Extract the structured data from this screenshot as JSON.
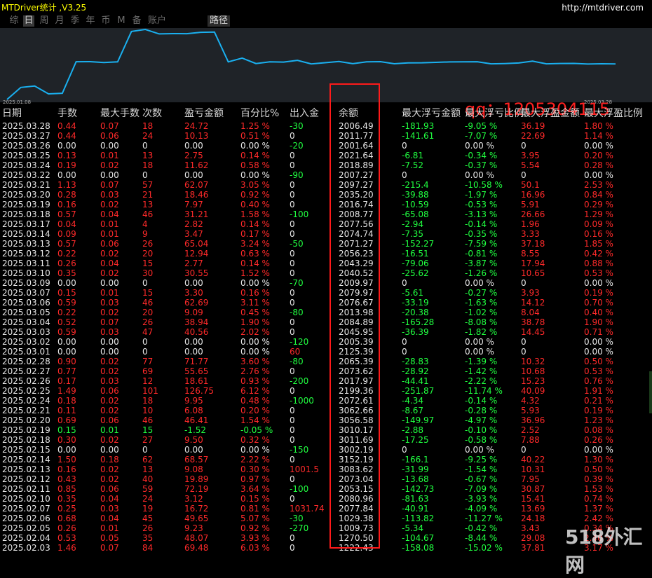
{
  "window": {
    "title": "MTDriver统计 ,V3.25",
    "url": "http://mtdriver.com"
  },
  "tabs": [
    {
      "label": "综",
      "active": false
    },
    {
      "label": "日",
      "active": true
    },
    {
      "label": "周",
      "active": false
    },
    {
      "label": "月",
      "active": false
    },
    {
      "label": "季",
      "active": false
    },
    {
      "label": "年",
      "active": false
    },
    {
      "label": "币",
      "active": false
    },
    {
      "label": "M",
      "active": false
    },
    {
      "label": "备",
      "active": false
    },
    {
      "label": "账户",
      "active": false
    }
  ],
  "path_button": "路径",
  "chart": {
    "date_start": "2025.01.08",
    "date_end": "2025.03.28",
    "line_color": "#1ab0f0",
    "watermark": "qq：1205304115"
  },
  "columns": [
    "日期",
    "手数",
    "最大手数",
    "次数",
    "盈亏金额",
    "百分比%",
    "出入金",
    "余额",
    "最大浮亏金额",
    "最大浮亏比例",
    "最大浮盈金额",
    "最大浮盈比例"
  ],
  "rows": [
    [
      "2025.03.28",
      "0.44",
      "0.07",
      "18",
      "24.72",
      "1.25 %",
      "-30",
      "2006.49",
      "-181.93",
      "-9.05 %",
      "36.19",
      "1.80 %"
    ],
    [
      "2025.03.27",
      "0.44",
      "0.06",
      "24",
      "10.13",
      "0.51 %",
      "0",
      "2011.77",
      "-141.61",
      "-7.07 %",
      "22.69",
      "1.14 %"
    ],
    [
      "2025.03.26",
      "0.00",
      "0.00",
      "0",
      "0.00",
      "0.00 %",
      "-20",
      "2001.64",
      "0",
      "0.00 %",
      "0",
      "0.00 %"
    ],
    [
      "2025.03.25",
      "0.13",
      "0.01",
      "13",
      "2.75",
      "0.14 %",
      "0",
      "2021.64",
      "-6.81",
      "-0.34 %",
      "3.95",
      "0.20 %"
    ],
    [
      "2025.03.24",
      "0.19",
      "0.02",
      "18",
      "11.62",
      "0.58 %",
      "0",
      "2018.89",
      "-7.52",
      "-0.37 %",
      "5.54",
      "0.28 %"
    ],
    [
      "2025.03.22",
      "0.00",
      "0.00",
      "0",
      "0.00",
      "0.00 %",
      "-90",
      "2007.27",
      "0",
      "0.00 %",
      "0",
      "0.00 %"
    ],
    [
      "2025.03.21",
      "1.13",
      "0.07",
      "57",
      "62.07",
      "3.05 %",
      "0",
      "2097.27",
      "-215.4",
      "-10.58 %",
      "50.1",
      "2.53 %"
    ],
    [
      "2025.03.20",
      "0.28",
      "0.03",
      "21",
      "18.46",
      "0.92 %",
      "0",
      "2035.20",
      "-39.88",
      "-1.97 %",
      "16.96",
      "0.84 %"
    ],
    [
      "2025.03.19",
      "0.16",
      "0.02",
      "13",
      "7.97",
      "0.40 %",
      "0",
      "2016.74",
      "-10.59",
      "-0.53 %",
      "5.91",
      "0.29 %"
    ],
    [
      "2025.03.18",
      "0.57",
      "0.04",
      "46",
      "31.21",
      "1.58 %",
      "-100",
      "2008.77",
      "-65.08",
      "-3.13 %",
      "26.66",
      "1.29 %"
    ],
    [
      "2025.03.17",
      "0.04",
      "0.01",
      "4",
      "2.82",
      "0.14 %",
      "0",
      "2077.56",
      "-2.94",
      "-0.14 %",
      "1.96",
      "0.09 %"
    ],
    [
      "2025.03.14",
      "0.09",
      "0.01",
      "9",
      "3.47",
      "0.17 %",
      "0",
      "2074.74",
      "-7.35",
      "-0.35 %",
      "3.33",
      "0.16 %"
    ],
    [
      "2025.03.13",
      "0.57",
      "0.06",
      "26",
      "65.04",
      "3.24 %",
      "-50",
      "2071.27",
      "-152.27",
      "-7.59 %",
      "37.18",
      "1.85 %"
    ],
    [
      "2025.03.12",
      "0.22",
      "0.02",
      "20",
      "12.94",
      "0.63 %",
      "0",
      "2056.23",
      "-16.51",
      "-0.81 %",
      "8.55",
      "0.42 %"
    ],
    [
      "2025.03.11",
      "0.26",
      "0.04",
      "15",
      "2.77",
      "0.14 %",
      "0",
      "2043.29",
      "-79.06",
      "-3.87 %",
      "17.94",
      "0.88 %"
    ],
    [
      "2025.03.10",
      "0.35",
      "0.02",
      "30",
      "30.55",
      "1.52 %",
      "0",
      "2040.52",
      "-25.62",
      "-1.26 %",
      "10.65",
      "0.53 %"
    ],
    [
      "2025.03.09",
      "0.00",
      "0.00",
      "0",
      "0.00",
      "0.00 %",
      "-70",
      "2009.97",
      "0",
      "0.00 %",
      "0",
      "0.00 %"
    ],
    [
      "2025.03.07",
      "0.15",
      "0.01",
      "15",
      "3.30",
      "0.16 %",
      "0",
      "2079.97",
      "-5.61",
      "-0.27 %",
      "3.93",
      "0.19 %"
    ],
    [
      "2025.03.06",
      "0.59",
      "0.03",
      "46",
      "62.69",
      "3.11 %",
      "0",
      "2076.67",
      "-33.19",
      "-1.63 %",
      "14.12",
      "0.70 %"
    ],
    [
      "2025.03.05",
      "0.22",
      "0.02",
      "20",
      "9.09",
      "0.45 %",
      "-80",
      "2013.98",
      "-20.38",
      "-1.02 %",
      "8.04",
      "0.40 %"
    ],
    [
      "2025.03.04",
      "0.52",
      "0.07",
      "26",
      "38.94",
      "1.90 %",
      "0",
      "2084.89",
      "-165.28",
      "-8.08 %",
      "38.78",
      "1.90 %"
    ],
    [
      "2025.03.03",
      "0.59",
      "0.03",
      "47",
      "40.56",
      "2.02 %",
      "0",
      "2045.95",
      "-36.39",
      "-1.82 %",
      "14.45",
      "0.71 %"
    ],
    [
      "2025.03.02",
      "0.00",
      "0.00",
      "0",
      "0.00",
      "0.00 %",
      "-120",
      "2005.39",
      "0",
      "0.00 %",
      "0",
      "0.00 %"
    ],
    [
      "2025.03.01",
      "0.00",
      "0.00",
      "0",
      "0.00",
      "0.00 %",
      "60",
      "2125.39",
      "0",
      "0.00 %",
      "0",
      "0.00 %"
    ],
    [
      "2025.02.28",
      "0.90",
      "0.02",
      "77",
      "71.77",
      "3.60 %",
      "-80",
      "2065.39",
      "-28.83",
      "-1.39 %",
      "10.32",
      "0.50 %"
    ],
    [
      "2025.02.27",
      "0.77",
      "0.02",
      "69",
      "55.65",
      "2.76 %",
      "0",
      "2073.62",
      "-28.92",
      "-1.42 %",
      "10.68",
      "0.53 %"
    ],
    [
      "2025.02.26",
      "0.17",
      "0.03",
      "12",
      "18.61",
      "0.93 %",
      "-200",
      "2017.97",
      "-44.41",
      "-2.22 %",
      "15.23",
      "0.76 %"
    ],
    [
      "2025.02.25",
      "1.49",
      "0.06",
      "101",
      "126.75",
      "6.12 %",
      "0",
      "2199.36",
      "-251.87",
      "-11.74 %",
      "40.09",
      "1.91 %"
    ],
    [
      "2025.02.24",
      "0.18",
      "0.02",
      "18",
      "9.95",
      "0.48 %",
      "-1000",
      "2072.61",
      "-4.34",
      "-0.14 %",
      "4.32",
      "0.21 %"
    ],
    [
      "2025.02.21",
      "0.11",
      "0.02",
      "10",
      "6.08",
      "0.20 %",
      "0",
      "3062.66",
      "-8.67",
      "-0.28 %",
      "5.93",
      "0.19 %"
    ],
    [
      "2025.02.20",
      "0.69",
      "0.06",
      "46",
      "46.41",
      "1.54 %",
      "0",
      "3056.58",
      "-149.97",
      "-4.97 %",
      "36.96",
      "1.23 %"
    ],
    [
      "2025.02.19",
      "0.15",
      "0.01",
      "15",
      "-1.52",
      "-0.05 %",
      "0",
      "3010.17",
      "-2.88",
      "-0.10 %",
      "2.52",
      "0.08 %"
    ],
    [
      "2025.02.18",
      "0.30",
      "0.02",
      "27",
      "9.50",
      "0.32 %",
      "0",
      "3011.69",
      "-17.25",
      "-0.58 %",
      "7.88",
      "0.26 %"
    ],
    [
      "2025.02.15",
      "0.00",
      "0.00",
      "0",
      "0.00",
      "0.00 %",
      "-150",
      "3002.19",
      "0",
      "0.00 %",
      "0",
      "0.00 %"
    ],
    [
      "2025.02.14",
      "1.50",
      "0.18",
      "62",
      "68.57",
      "2.22 %",
      "0",
      "3152.19",
      "-166.1",
      "-9.25 %",
      "40.22",
      "1.30 %"
    ],
    [
      "2025.02.13",
      "0.16",
      "0.02",
      "13",
      "9.08",
      "0.30 %",
      "1001.5",
      "3083.62",
      "-31.99",
      "-1.54 %",
      "10.31",
      "0.50 %"
    ],
    [
      "2025.02.12",
      "0.43",
      "0.02",
      "40",
      "19.89",
      "0.97 %",
      "0",
      "2073.04",
      "-13.68",
      "-0.67 %",
      "7.95",
      "0.39 %"
    ],
    [
      "2025.02.11",
      "0.85",
      "0.06",
      "59",
      "72.19",
      "3.64 %",
      "-100",
      "2053.15",
      "-142.73",
      "-7.09 %",
      "30.87",
      "1.53 %"
    ],
    [
      "2025.02.10",
      "0.35",
      "0.04",
      "24",
      "3.12",
      "0.15 %",
      "0",
      "2080.96",
      "-81.63",
      "-3.93 %",
      "15.41",
      "0.74 %"
    ],
    [
      "2025.02.07",
      "0.25",
      "0.03",
      "19",
      "16.72",
      "0.81 %",
      "1031.74",
      "2077.84",
      "-40.91",
      "-4.09 %",
      "13.69",
      "1.37 %"
    ],
    [
      "2025.02.06",
      "0.68",
      "0.04",
      "45",
      "49.65",
      "5.07 %",
      "-30",
      "1029.38",
      "-113.82",
      "-11.27 %",
      "24.18",
      "2.42 %"
    ],
    [
      "2025.02.05",
      "0.26",
      "0.01",
      "26",
      "9.23",
      "0.92 %",
      "-270",
      "1009.73",
      "-5.34",
      "-0.42 %",
      "3.43",
      "0.34 %"
    ],
    [
      "2025.02.04",
      "0.53",
      "0.05",
      "35",
      "48.07",
      "3.93 %",
      "0",
      "1270.50",
      "-104.67",
      "-8.44 %",
      "29.08",
      "2.40 %"
    ],
    [
      "2025.02.03",
      "1.46",
      "0.07",
      "84",
      "69.48",
      "6.03 %",
      "0",
      "1222.43",
      "-158.08",
      "-15.02 %",
      "37.81",
      "3.17 %"
    ]
  ],
  "logo": "518外汇网"
}
